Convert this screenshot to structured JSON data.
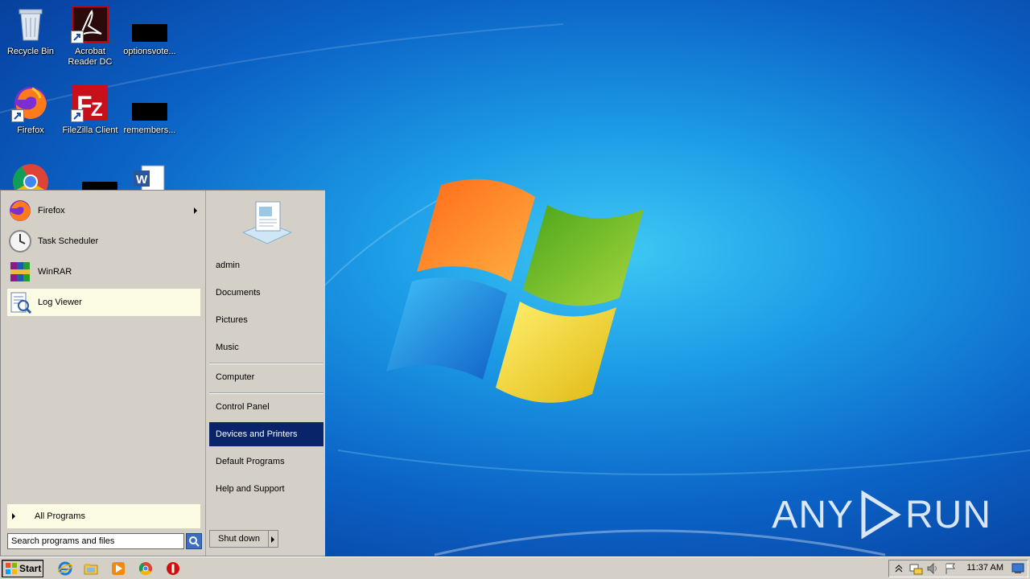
{
  "desktop_icons": [
    {
      "label": "Recycle Bin",
      "icon": "recycle-bin-icon"
    },
    {
      "label": "Acrobat Reader DC",
      "icon": "acrobat-icon"
    },
    {
      "label": "optionsvote...",
      "icon": "redacted-file-icon"
    },
    {
      "label": "Firefox",
      "icon": "firefox-icon"
    },
    {
      "label": "FileZilla Client",
      "icon": "filezilla-icon"
    },
    {
      "label": "remembers...",
      "icon": "redacted-file-icon"
    }
  ],
  "start_menu": {
    "programs": [
      {
        "label": "Firefox",
        "icon": "firefox-icon",
        "has_submenu": true
      },
      {
        "label": "Task Scheduler",
        "icon": "clock-icon"
      },
      {
        "label": "WinRAR",
        "icon": "winrar-icon"
      },
      {
        "label": "Log Viewer",
        "icon": "log-viewer-icon",
        "highlighted": true
      }
    ],
    "all_programs_label": "All Programs",
    "search_placeholder": "Search programs and files",
    "right_items": {
      "user": "admin",
      "documents": "Documents",
      "pictures": "Pictures",
      "music": "Music",
      "computer": "Computer",
      "control_panel": "Control Panel",
      "devices_printers": "Devices and Printers",
      "default_programs": "Default Programs",
      "help_support": "Help and Support"
    },
    "selected_item": "Devices and Printers",
    "shutdown_label": "Shut down"
  },
  "taskbar": {
    "start_label": "Start",
    "pinned": [
      "internet-explorer-icon",
      "explorer-folder-icon",
      "media-player-icon",
      "chrome-icon",
      "stop-icon"
    ],
    "clock": "11:37 AM"
  },
  "watermark": {
    "left": "ANY",
    "right": "RUN"
  }
}
